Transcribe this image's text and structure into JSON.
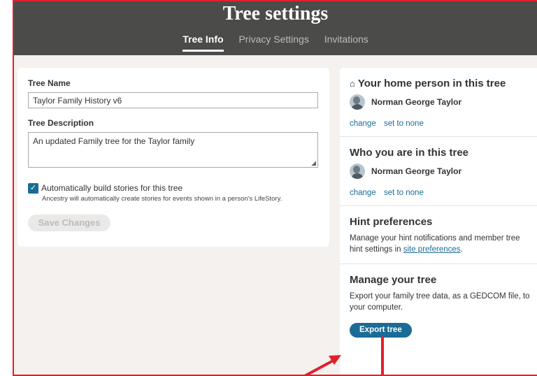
{
  "header": {
    "title": "Tree settings",
    "tabs": [
      {
        "label": "Tree Info",
        "active": true
      },
      {
        "label": "Privacy Settings",
        "active": false
      },
      {
        "label": "Invitations",
        "active": false
      }
    ]
  },
  "tree_info": {
    "name_label": "Tree Name",
    "name_value": "Taylor Family History v6",
    "description_label": "Tree Description",
    "description_value": "An updated Family tree for the Taylor family",
    "auto_stories_label": "Automatically build stories for this tree",
    "auto_stories_checked": true,
    "auto_stories_help": "Ancestry will automatically create stories for events shown in a person's LifeStory.",
    "save_label": "Save Changes"
  },
  "home_person": {
    "title": "Your home person in this tree",
    "person": "Norman George Taylor",
    "change": "change",
    "set_none": "set to none"
  },
  "who_you_are": {
    "title": "Who you are in this tree",
    "person": "Norman George Taylor",
    "change": "change",
    "set_none": "set to none"
  },
  "hint_preferences": {
    "title": "Hint preferences",
    "text": "Manage your hint notifications and member tree hint settings in ",
    "link": "site preferences",
    "text_end": "."
  },
  "manage_tree": {
    "title": "Manage your tree",
    "text": "Export your family tree data, as a GEDCOM file, to your computer.",
    "export_label": "Export tree"
  },
  "colors": {
    "header_bg": "#4b4b4a",
    "accent": "#1a6c97",
    "annotation": "#e0202a"
  }
}
